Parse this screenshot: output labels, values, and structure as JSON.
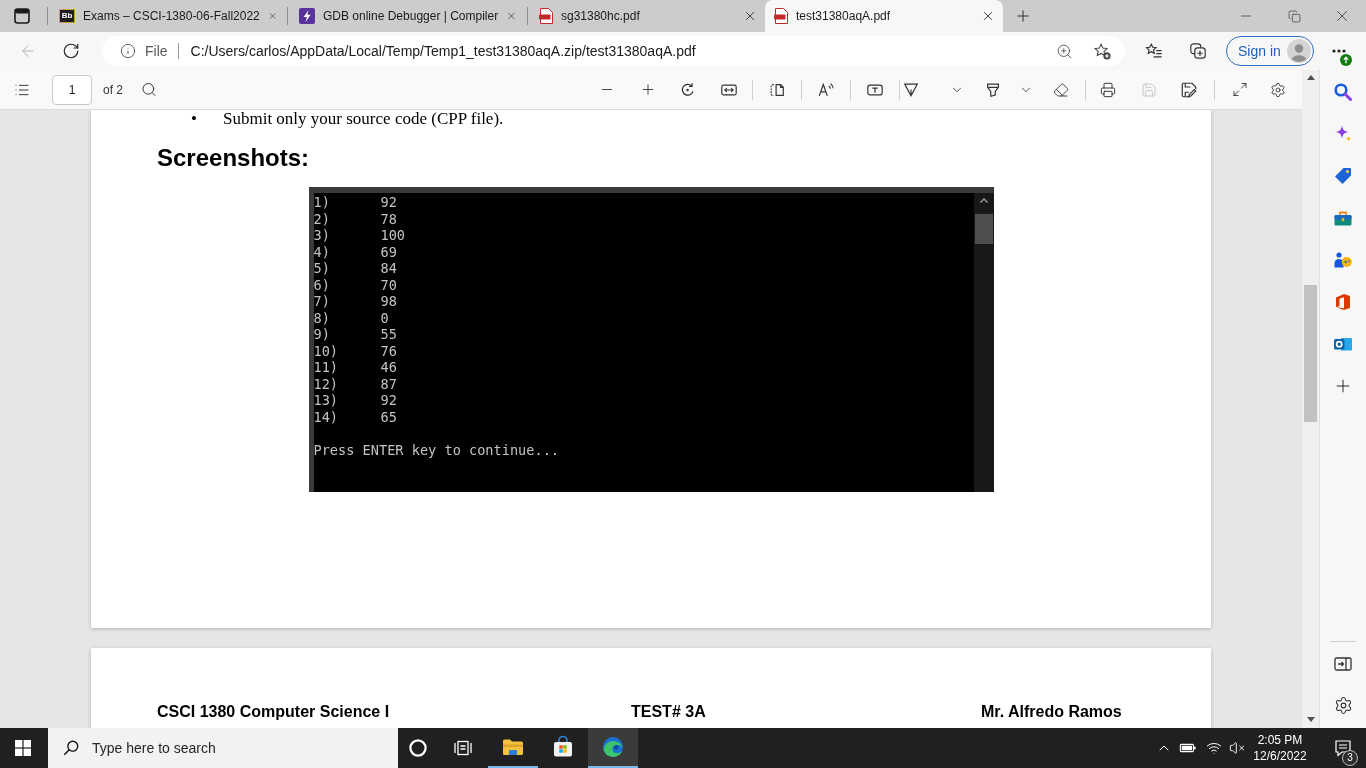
{
  "browser": {
    "tabs": [
      {
        "kind": "letters",
        "icon_text": "Bb",
        "title": "Exams – CSCI-1380-06-Fall2022",
        "selected": false
      },
      {
        "kind": "bolt",
        "title": "GDB online Debugger | Compiler",
        "selected": false
      },
      {
        "kind": "pdf",
        "title": "sg31380hc.pdf",
        "selected": false
      },
      {
        "kind": "pdf",
        "title": "test31380aqA.pdf",
        "selected": true
      }
    ],
    "navigation": {
      "back": {
        "disabled": true
      },
      "site_label": "File",
      "url": "C:/Users/carlos/AppData/Local/Temp/Temp1_test31380aqA.zip/test31380aqA.pdf",
      "sign_in": "Sign in"
    }
  },
  "pdf_toolbar": {
    "page": "1",
    "page_count": "of 2",
    "save": {
      "disabled": true
    }
  },
  "document": {
    "bullet": "•",
    "bullet_text": "Submit only your source code (CPP file).",
    "heading": "Screenshots:",
    "console": {
      "lines": [
        {
          "index": "1)",
          "value": "92"
        },
        {
          "index": "2)",
          "value": "78"
        },
        {
          "index": "3)",
          "value": "100"
        },
        {
          "index": "4)",
          "value": "69"
        },
        {
          "index": "5)",
          "value": "84"
        },
        {
          "index": "6)",
          "value": "70"
        },
        {
          "index": "7)",
          "value": "98"
        },
        {
          "index": "8)",
          "value": "0"
        },
        {
          "index": "9)",
          "value": "55"
        },
        {
          "index": "10)",
          "value": "76"
        },
        {
          "index": "11)",
          "value": "46"
        },
        {
          "index": "12)",
          "value": "87"
        },
        {
          "index": "13)",
          "value": "92"
        },
        {
          "index": "14)",
          "value": "65"
        }
      ],
      "prompt": "Press ENTER key to continue..."
    },
    "next_page_header": [
      "CSCI 1380 Computer Science I",
      "TEST# 3A",
      "Mr. Alfredo Ramos"
    ]
  },
  "taskbar": {
    "search": {
      "placeholder": "Type here to search"
    },
    "apps": [
      {
        "kind": "folder",
        "open": true,
        "active": false
      },
      {
        "kind": "store",
        "open": false,
        "active": false
      },
      {
        "kind": "swirl",
        "open": true,
        "active": true
      }
    ],
    "time": "2:05 PM",
    "date": "12/6/2022",
    "notifications": "3"
  }
}
